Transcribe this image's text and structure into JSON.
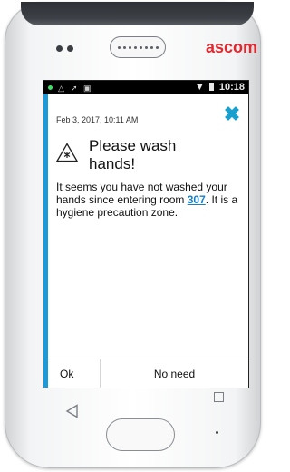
{
  "device": {
    "brand": "ascom",
    "brand_color": "#e0282e"
  },
  "statusbar": {
    "time": "10:18",
    "icons": [
      "notification-dot-icon",
      "warning-icon",
      "tools-icon",
      "image-icon",
      "wifi-icon",
      "battery-icon"
    ]
  },
  "alert": {
    "timestamp": "Feb 3, 2017, 10:11 AM",
    "title": "Please wash hands!",
    "message_before": "It seems you have not washed your hands since entering room ",
    "room": "307",
    "message_after": ". It is a hygiene precaution zone.",
    "accent_color": "#1a9ad8",
    "close_icon": "close-icon"
  },
  "actions": {
    "ok_label": "Ok",
    "no_need_label": "No need"
  },
  "hardware": {
    "back_icon": "back-icon",
    "home_icon": "home-button",
    "menu_icon": "menu-icon"
  }
}
